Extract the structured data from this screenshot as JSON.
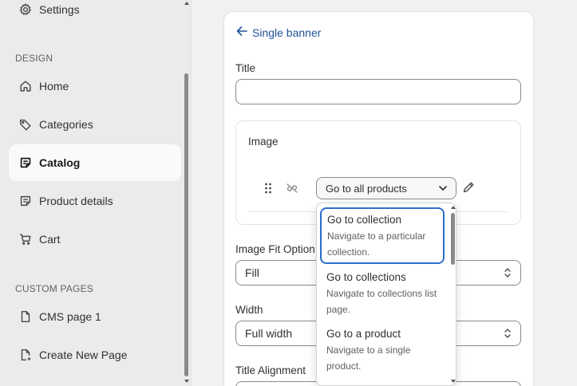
{
  "sidebar": {
    "items": [
      {
        "label": "Settings",
        "icon": "gear-icon"
      },
      {
        "label": "Home",
        "icon": "home-icon"
      },
      {
        "label": "Categories",
        "icon": "tag-icon"
      },
      {
        "label": "Catalog",
        "icon": "catalog-icon",
        "active": true
      },
      {
        "label": "Product details",
        "icon": "product-details-icon"
      },
      {
        "label": "Cart",
        "icon": "cart-icon"
      },
      {
        "label": "CMS page 1",
        "icon": "page-icon"
      },
      {
        "label": "Create New Page",
        "icon": "page-add-icon"
      }
    ],
    "sections": {
      "design": "DESIGN",
      "custom_pages": "CUSTOM PAGES"
    }
  },
  "panel": {
    "back_label": "Single banner",
    "title_label": "Title",
    "title_value": "",
    "image_label": "Image",
    "action_value": "Go to all products",
    "image_fit_label": "Image Fit Option",
    "image_fit_value": "Fill",
    "width_label": "Width",
    "width_value": "Full width",
    "title_alignment_label": "Title Alignment"
  },
  "dropdown": {
    "options": [
      {
        "title": "Go to collection",
        "desc_line1": "Navigate to a particular",
        "desc_line2": "collection.",
        "selected": true
      },
      {
        "title": "Go to collections",
        "desc_line1": "Navigate to collections list",
        "desc_line2": "page."
      },
      {
        "title": "Go to a product",
        "desc_line1": "Navigate to a single",
        "desc_line2": "product."
      }
    ]
  },
  "colors": {
    "accent": "#2c6ecb",
    "link": "#1f5199",
    "sidebar_bg": "#ebebeb",
    "active_bg": "#fafafa"
  }
}
